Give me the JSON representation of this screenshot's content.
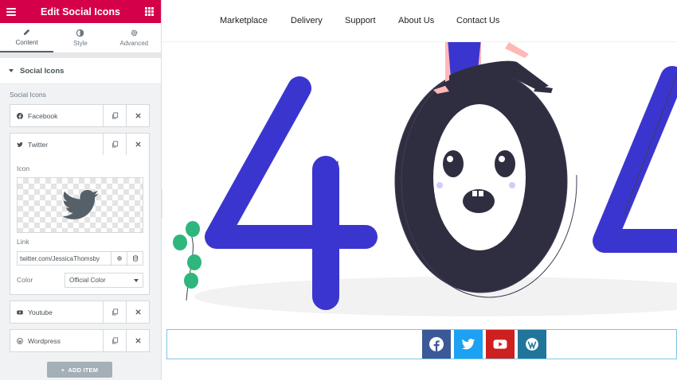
{
  "editor": {
    "title": "Edit Social Icons",
    "tabs": [
      {
        "label": "Content",
        "icon": "pencil-icon"
      },
      {
        "label": "Style",
        "icon": "half-circle-icon"
      },
      {
        "label": "Advanced",
        "icon": "gear-icon"
      }
    ],
    "section_title": "Social Icons",
    "field_label": "Social Icons",
    "items": [
      {
        "label": "Facebook",
        "icon": "facebook-icon"
      },
      {
        "label": "Twitter",
        "icon": "twitter-icon"
      },
      {
        "label": "Youtube",
        "icon": "youtube-icon"
      },
      {
        "label": "Wordpress",
        "icon": "wordpress-icon"
      }
    ],
    "expanded": {
      "icon_label": "Icon",
      "link_label": "Link",
      "link_value": "twitter.com/JessicaThomsby",
      "color_label": "Color",
      "color_value": "Official Color"
    },
    "add_item_label": "ADD ITEM",
    "accent_color": "#d5004a"
  },
  "site": {
    "nav": [
      "Marketplace",
      "Delivery",
      "Support",
      "About Us",
      "Contact Us"
    ],
    "social": [
      {
        "name": "facebook",
        "color": "#3b5998"
      },
      {
        "name": "twitter",
        "color": "#1da1f2"
      },
      {
        "name": "youtube",
        "color": "#cd201f"
      },
      {
        "name": "wordpress",
        "color": "#21759b"
      }
    ]
  }
}
